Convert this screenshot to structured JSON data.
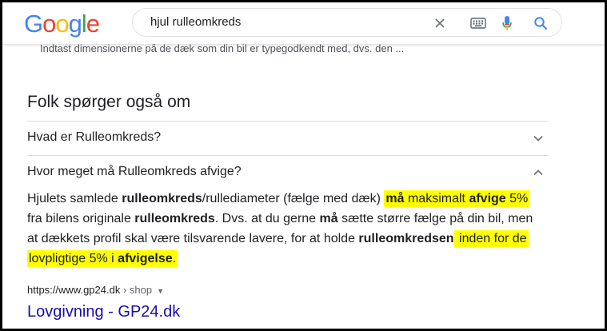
{
  "logo": {
    "text": "Google",
    "colors": [
      "#4285F4",
      "#EA4335",
      "#FBBC05",
      "#4285F4",
      "#34A853",
      "#EA4335"
    ]
  },
  "search": {
    "query": "hjul rulleomkreds"
  },
  "icons": {
    "clear": "close-icon",
    "keyboard": "keyboard-icon",
    "voice": "mic-icon",
    "search": "search-icon"
  },
  "snippet_tail": "Indtast dimensionerne på de dæk som din bil er typegodkendt med, dvs. den ...",
  "paa": {
    "title": "Folk spørger også om",
    "questions": [
      {
        "text": "Hvad er Rulleomkreds?",
        "expanded": false
      },
      {
        "text": "Hvor meget må Rulleomkreds afvige?",
        "expanded": true
      }
    ]
  },
  "answer": {
    "p1": "Hjulets samlede ",
    "b1": "rulleomkreds",
    "p2": "/rullediameter (fælge med dæk) ",
    "h1b": "må",
    "h1a": " maksimalt ",
    "h1c": "afvige",
    "h1d": " 5%",
    "p3": " fra bilens originale ",
    "b2": "rulleomkreds",
    "p4": ". Dvs. at du gerne ",
    "b3": "må",
    "p5": " sætte større fælge på din bil, men at dækkets profil skal være tilsvarende lavere, for at holde ",
    "b4": "rulleomkredsen",
    "h2a": " inden for de",
    "h3a": "lovpligtige 5% i ",
    "h3b": "afvigelse",
    "h3c": ".",
    "highlight_color": "#ffff00"
  },
  "result": {
    "domain": "https://www.gp24.dk",
    "path": " › shop",
    "title": "Lovgivning - GP24.dk"
  }
}
